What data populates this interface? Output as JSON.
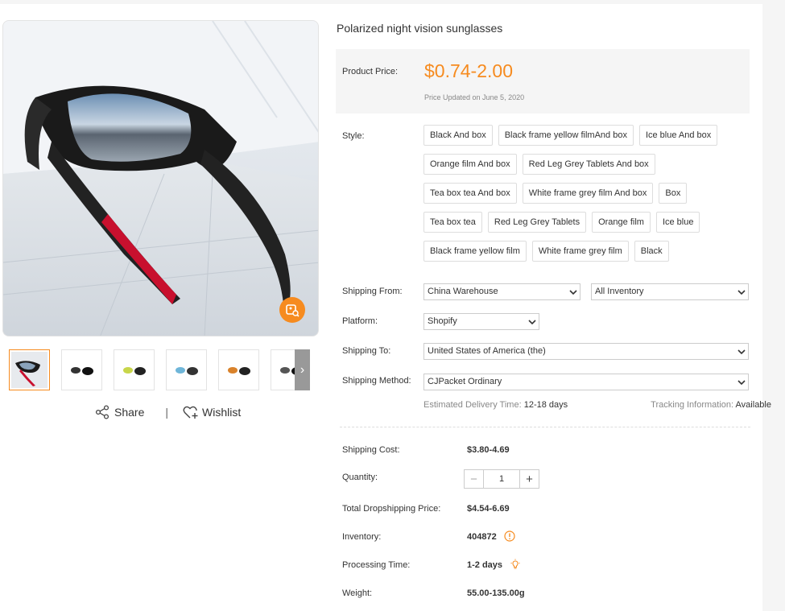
{
  "product": {
    "title": "Polarized night vision sunglasses",
    "price_label": "Product Price:",
    "price": "$0.74-2.00",
    "price_updated": "Price Updated on June 5, 2020"
  },
  "style": {
    "label": "Style:",
    "options": [
      "Black And box",
      "Black frame yellow filmAnd box",
      "Ice blue And box",
      "Orange film And box",
      "Red Leg Grey Tablets And box",
      "Tea box tea And box",
      "White frame grey film And box",
      "Box",
      "Tea box tea",
      "Red Leg Grey Tablets",
      "Orange film",
      "Ice blue",
      "Black frame yellow film",
      "White frame grey film",
      "Black"
    ]
  },
  "shipping": {
    "from_label": "Shipping From:",
    "from_value": "China Warehouse",
    "inventory_value": "All Inventory",
    "platform_label": "Platform:",
    "platform_value": "Shopify",
    "to_label": "Shipping To:",
    "to_value": "United States of America (the)",
    "method_label": "Shipping Method:",
    "method_value": "CJPacket Ordinary",
    "est_label": "Estimated Delivery Time:",
    "est_value": "12-18 days",
    "tracking_label": "Tracking Information:",
    "tracking_value": "Available"
  },
  "summary": {
    "cost_label": "Shipping Cost:",
    "cost_value": "$3.80-4.69",
    "qty_label": "Quantity:",
    "qty_value": "1",
    "qty_minus": "−",
    "qty_plus": "+",
    "total_label": "Total Dropshipping Price:",
    "total_value": "$4.54-6.69",
    "inventory_label": "Inventory:",
    "inventory_value": "404872",
    "processing_label": "Processing Time:",
    "processing_value": "1-2 days",
    "weight_label": "Weight:",
    "weight_value": "55.00-135.00g"
  },
  "actions": {
    "share": "Share",
    "separator": "|",
    "wishlist": "Wishlist"
  },
  "gallery": {
    "thumb_count": 6,
    "next_arrow": "›"
  },
  "icons": {
    "zoom": "image-search-icon",
    "share": "share-icon",
    "wishlist": "heart-plus-icon",
    "inventory_info": "info-circle-icon",
    "processing": "bulb-icon",
    "select_arrow": "chevron-down-icon"
  },
  "colors": {
    "accent": "#f68b1f",
    "price_bg": "#f5f5f5"
  }
}
